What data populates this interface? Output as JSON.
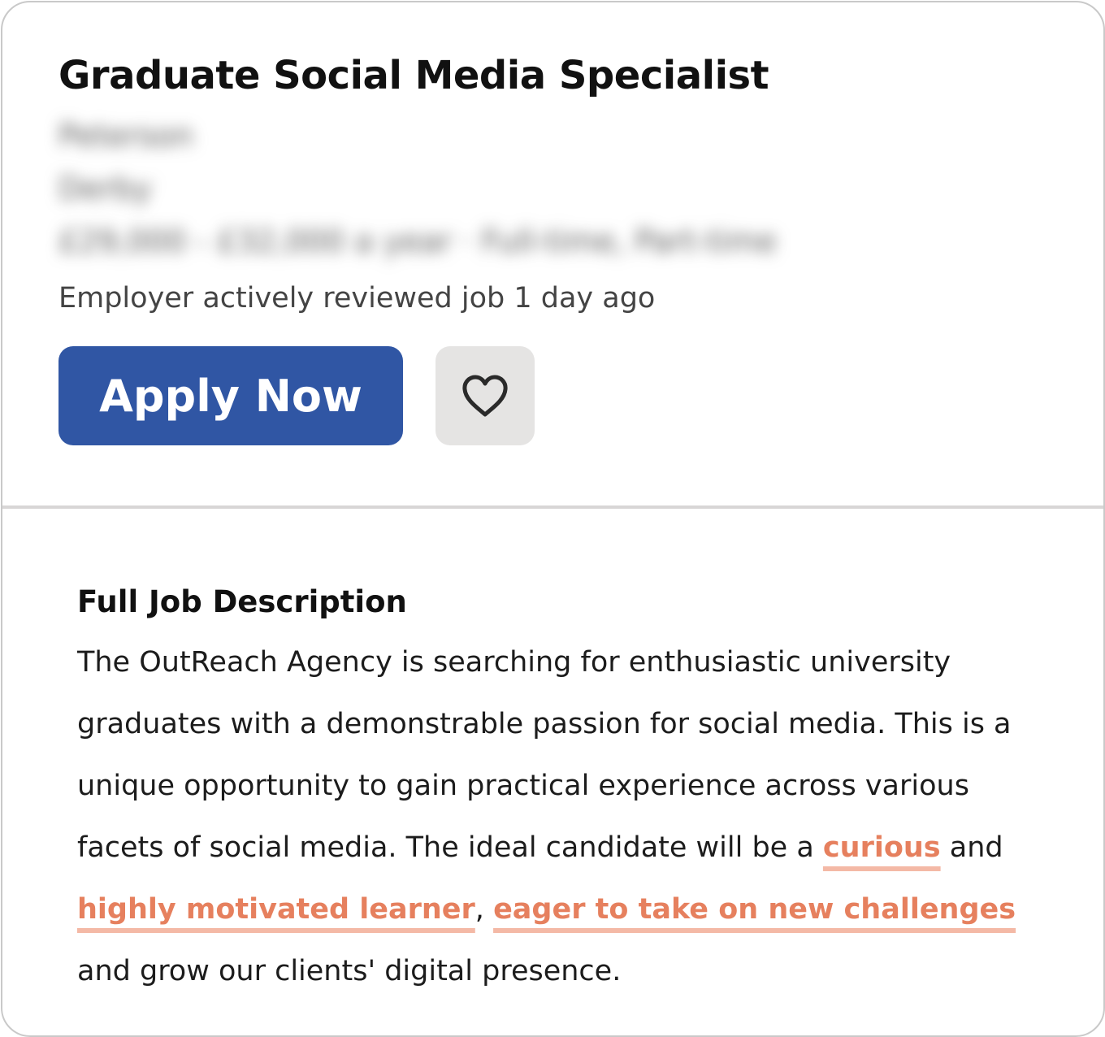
{
  "job": {
    "title": "Graduate Social Media Specialist",
    "company": "Peterson",
    "location": "Derby",
    "salary_type": "£29,000 - £32,000 a year  ·  Full-time, Part-time",
    "activity": "Employer actively reviewed job 1 day ago"
  },
  "actions": {
    "apply_label": "Apply Now",
    "save_icon": "heart-icon"
  },
  "description": {
    "heading": "Full Job Description",
    "text_1": "The OutReach Agency is searching for enthusiastic university graduates with a demonstrable passion for social media. This is a unique opportunity to gain practical experience across various facets of social media. The ideal candidate will be a ",
    "highlight_1": "curious",
    "text_2": " and ",
    "highlight_2": "highly motivated learner",
    "text_3": ", ",
    "highlight_3": "eager to take on new challenges",
    "text_4": " and grow our clients' digital presence."
  },
  "colors": {
    "apply_button": "#3056a4",
    "save_button": "#e5e4e3",
    "highlight_text": "#e6805e",
    "highlight_underline": "#f4b9a6"
  }
}
